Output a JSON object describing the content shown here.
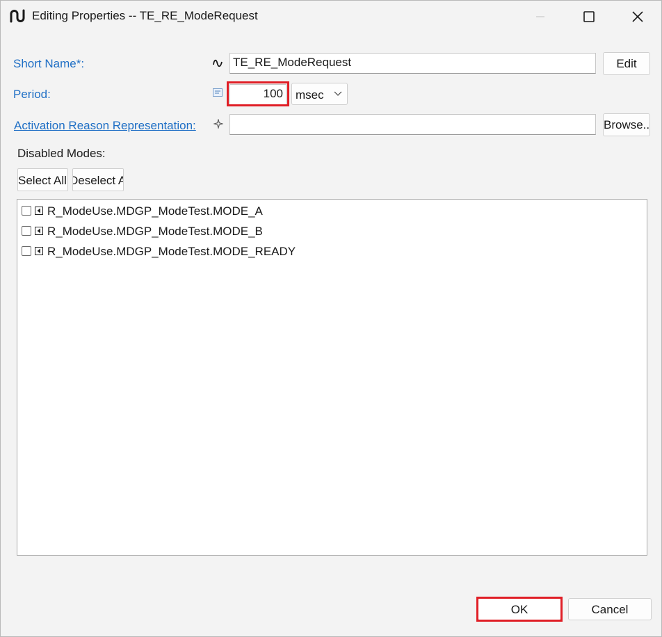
{
  "window": {
    "title": "Editing Properties -- TE_RE_ModeRequest"
  },
  "form": {
    "short_name_label": "Short Name*:",
    "short_name_value": "TE_RE_ModeRequest",
    "edit_button": "Edit",
    "period_label": "Period:",
    "period_value": "100",
    "period_unit": "msec",
    "activation_label": "Activation Reason Representation:",
    "activation_value": "",
    "browse_button": "Browse..."
  },
  "modes": {
    "label": "Disabled Modes:",
    "select_all": "Select All",
    "deselect_all": "Deselect A",
    "items": [
      {
        "label": "R_ModeUse.MDGP_ModeTest.MODE_A",
        "checked": false
      },
      {
        "label": "R_ModeUse.MDGP_ModeTest.MODE_B",
        "checked": false
      },
      {
        "label": "R_ModeUse.MDGP_ModeTest.MODE_READY",
        "checked": false
      }
    ]
  },
  "footer": {
    "ok": "OK",
    "cancel": "Cancel"
  },
  "colors": {
    "link": "#1f6fc5",
    "highlight": "#e01e26",
    "background": "#f3f3f3"
  }
}
